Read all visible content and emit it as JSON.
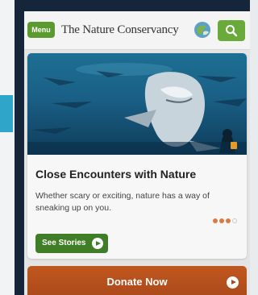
{
  "header": {
    "menu_label": "Menu",
    "brand_name": "The Nature Conservancy",
    "search_icon": "search-icon",
    "logo_icon": "globe-leaf-icon"
  },
  "feature": {
    "title": "Close Encounters with Nature",
    "body": "Whether scary or exciting, nature has a way of sneaking up on you.",
    "cta_label": "See Stories",
    "carousel": {
      "total": 4,
      "active": 3
    }
  },
  "donate": {
    "label": "Donate Now"
  },
  "colors": {
    "menu_green": "#5b9a2f",
    "cta_green": "#3f7e27",
    "donate_orange": "#b9521d"
  }
}
